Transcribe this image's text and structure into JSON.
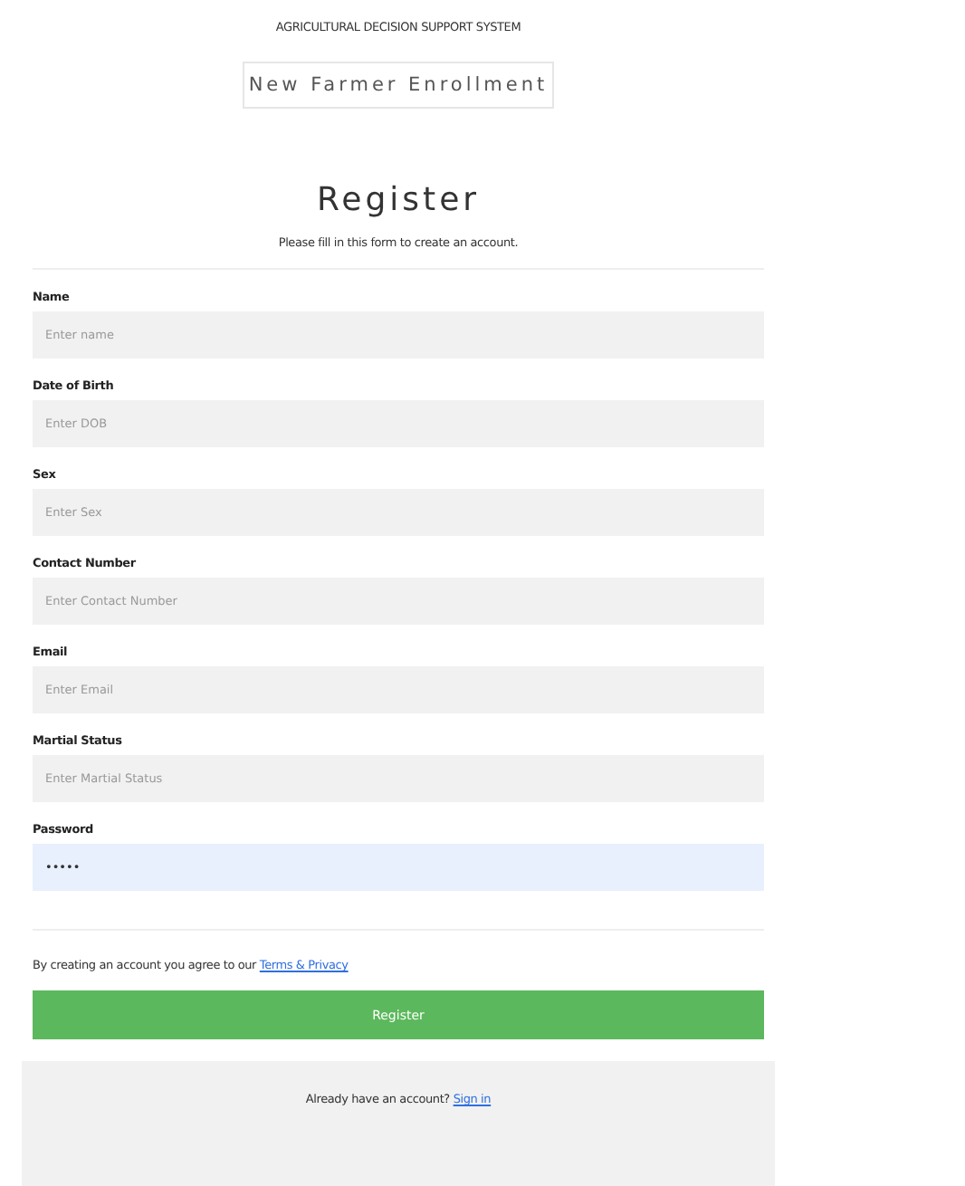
{
  "header": {
    "system_name": "AGRICULTURAL DECISION SUPPORT SYSTEM",
    "page_title": "New Farmer Enrollment"
  },
  "form": {
    "title": "Register",
    "subtitle": "Please fill in this form to create an account.",
    "fields": [
      {
        "label": "Name",
        "placeholder": "Enter name",
        "focused": false
      },
      {
        "label": "Date of Birth",
        "placeholder": "Enter DOB",
        "focused": false
      },
      {
        "label": "Sex",
        "placeholder": "Enter Sex",
        "focused": false
      },
      {
        "label": "Contact Number",
        "placeholder": "Enter Contact Number",
        "focused": false
      },
      {
        "label": "Email",
        "placeholder": "Enter Email",
        "focused": false
      },
      {
        "label": "Martial Status",
        "placeholder": "Enter Martial Status",
        "focused": false
      },
      {
        "label": "Password",
        "value": "•••••",
        "focused": true
      }
    ],
    "terms": {
      "text": "By creating an account you agree to our",
      "link": "Terms & Privacy"
    },
    "submit": "Register"
  },
  "footer": {
    "text": "Already have an account?",
    "link": "Sign in"
  }
}
